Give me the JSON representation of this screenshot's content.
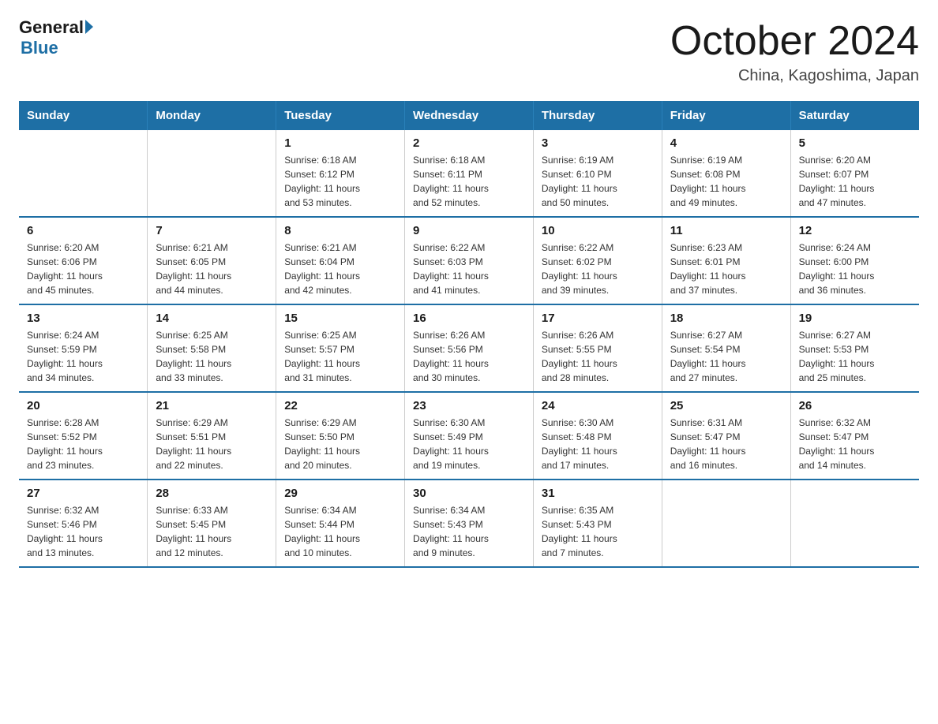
{
  "logo": {
    "general": "General",
    "blue": "Blue"
  },
  "header": {
    "month": "October 2024",
    "location": "China, Kagoshima, Japan"
  },
  "weekdays": [
    "Sunday",
    "Monday",
    "Tuesday",
    "Wednesday",
    "Thursday",
    "Friday",
    "Saturday"
  ],
  "weeks": [
    [
      {
        "day": "",
        "info": ""
      },
      {
        "day": "",
        "info": ""
      },
      {
        "day": "1",
        "info": "Sunrise: 6:18 AM\nSunset: 6:12 PM\nDaylight: 11 hours\nand 53 minutes."
      },
      {
        "day": "2",
        "info": "Sunrise: 6:18 AM\nSunset: 6:11 PM\nDaylight: 11 hours\nand 52 minutes."
      },
      {
        "day": "3",
        "info": "Sunrise: 6:19 AM\nSunset: 6:10 PM\nDaylight: 11 hours\nand 50 minutes."
      },
      {
        "day": "4",
        "info": "Sunrise: 6:19 AM\nSunset: 6:08 PM\nDaylight: 11 hours\nand 49 minutes."
      },
      {
        "day": "5",
        "info": "Sunrise: 6:20 AM\nSunset: 6:07 PM\nDaylight: 11 hours\nand 47 minutes."
      }
    ],
    [
      {
        "day": "6",
        "info": "Sunrise: 6:20 AM\nSunset: 6:06 PM\nDaylight: 11 hours\nand 45 minutes."
      },
      {
        "day": "7",
        "info": "Sunrise: 6:21 AM\nSunset: 6:05 PM\nDaylight: 11 hours\nand 44 minutes."
      },
      {
        "day": "8",
        "info": "Sunrise: 6:21 AM\nSunset: 6:04 PM\nDaylight: 11 hours\nand 42 minutes."
      },
      {
        "day": "9",
        "info": "Sunrise: 6:22 AM\nSunset: 6:03 PM\nDaylight: 11 hours\nand 41 minutes."
      },
      {
        "day": "10",
        "info": "Sunrise: 6:22 AM\nSunset: 6:02 PM\nDaylight: 11 hours\nand 39 minutes."
      },
      {
        "day": "11",
        "info": "Sunrise: 6:23 AM\nSunset: 6:01 PM\nDaylight: 11 hours\nand 37 minutes."
      },
      {
        "day": "12",
        "info": "Sunrise: 6:24 AM\nSunset: 6:00 PM\nDaylight: 11 hours\nand 36 minutes."
      }
    ],
    [
      {
        "day": "13",
        "info": "Sunrise: 6:24 AM\nSunset: 5:59 PM\nDaylight: 11 hours\nand 34 minutes."
      },
      {
        "day": "14",
        "info": "Sunrise: 6:25 AM\nSunset: 5:58 PM\nDaylight: 11 hours\nand 33 minutes."
      },
      {
        "day": "15",
        "info": "Sunrise: 6:25 AM\nSunset: 5:57 PM\nDaylight: 11 hours\nand 31 minutes."
      },
      {
        "day": "16",
        "info": "Sunrise: 6:26 AM\nSunset: 5:56 PM\nDaylight: 11 hours\nand 30 minutes."
      },
      {
        "day": "17",
        "info": "Sunrise: 6:26 AM\nSunset: 5:55 PM\nDaylight: 11 hours\nand 28 minutes."
      },
      {
        "day": "18",
        "info": "Sunrise: 6:27 AM\nSunset: 5:54 PM\nDaylight: 11 hours\nand 27 minutes."
      },
      {
        "day": "19",
        "info": "Sunrise: 6:27 AM\nSunset: 5:53 PM\nDaylight: 11 hours\nand 25 minutes."
      }
    ],
    [
      {
        "day": "20",
        "info": "Sunrise: 6:28 AM\nSunset: 5:52 PM\nDaylight: 11 hours\nand 23 minutes."
      },
      {
        "day": "21",
        "info": "Sunrise: 6:29 AM\nSunset: 5:51 PM\nDaylight: 11 hours\nand 22 minutes."
      },
      {
        "day": "22",
        "info": "Sunrise: 6:29 AM\nSunset: 5:50 PM\nDaylight: 11 hours\nand 20 minutes."
      },
      {
        "day": "23",
        "info": "Sunrise: 6:30 AM\nSunset: 5:49 PM\nDaylight: 11 hours\nand 19 minutes."
      },
      {
        "day": "24",
        "info": "Sunrise: 6:30 AM\nSunset: 5:48 PM\nDaylight: 11 hours\nand 17 minutes."
      },
      {
        "day": "25",
        "info": "Sunrise: 6:31 AM\nSunset: 5:47 PM\nDaylight: 11 hours\nand 16 minutes."
      },
      {
        "day": "26",
        "info": "Sunrise: 6:32 AM\nSunset: 5:47 PM\nDaylight: 11 hours\nand 14 minutes."
      }
    ],
    [
      {
        "day": "27",
        "info": "Sunrise: 6:32 AM\nSunset: 5:46 PM\nDaylight: 11 hours\nand 13 minutes."
      },
      {
        "day": "28",
        "info": "Sunrise: 6:33 AM\nSunset: 5:45 PM\nDaylight: 11 hours\nand 12 minutes."
      },
      {
        "day": "29",
        "info": "Sunrise: 6:34 AM\nSunset: 5:44 PM\nDaylight: 11 hours\nand 10 minutes."
      },
      {
        "day": "30",
        "info": "Sunrise: 6:34 AM\nSunset: 5:43 PM\nDaylight: 11 hours\nand 9 minutes."
      },
      {
        "day": "31",
        "info": "Sunrise: 6:35 AM\nSunset: 5:43 PM\nDaylight: 11 hours\nand 7 minutes."
      },
      {
        "day": "",
        "info": ""
      },
      {
        "day": "",
        "info": ""
      }
    ]
  ]
}
